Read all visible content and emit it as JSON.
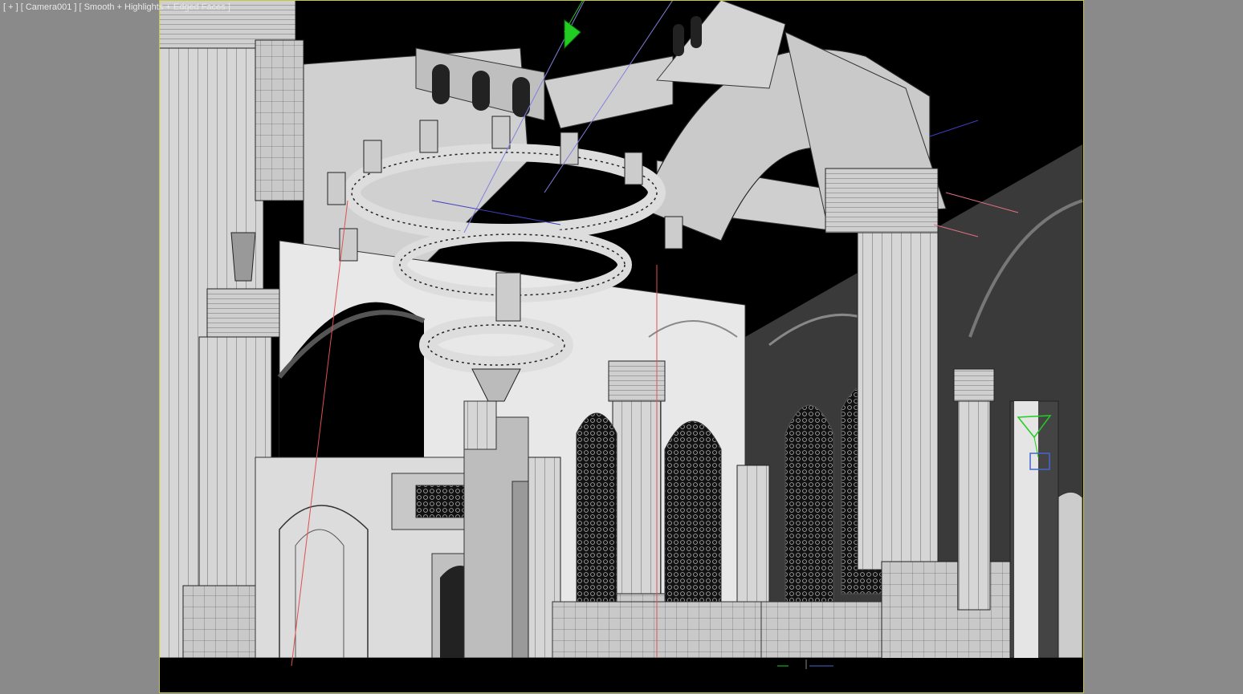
{
  "viewport": {
    "label_plus": "[ + ]",
    "label_camera": "[ Camera001 ]",
    "label_shading": "[ Smooth + Highlights + Edged Faces ]"
  },
  "colors": {
    "background": "#8a8a8a",
    "viewport_bg": "#000000",
    "border": "#c8c83a",
    "geometry_fill": "#d9d9d9",
    "wire": "#222222",
    "gizmo_green": "#22cc22",
    "gizmo_blue": "#4466cc",
    "gizmo_red": "#e05050"
  }
}
